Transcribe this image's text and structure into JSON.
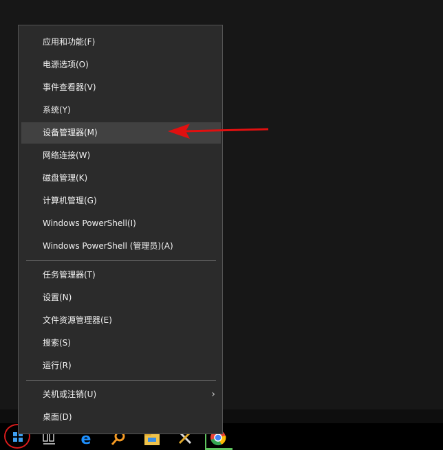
{
  "menu": {
    "items": [
      {
        "label": "应用和功能(F)"
      },
      {
        "label": "电源选项(O)"
      },
      {
        "label": "事件查看器(V)"
      },
      {
        "label": "系统(Y)"
      },
      {
        "label": "设备管理器(M)",
        "highlighted": true
      },
      {
        "label": "网络连接(W)"
      },
      {
        "label": "磁盘管理(K)"
      },
      {
        "label": "计算机管理(G)"
      },
      {
        "label": "Windows PowerShell(I)"
      },
      {
        "label": "Windows PowerShell (管理员)(A)"
      },
      {
        "label": "任务管理器(T)"
      },
      {
        "label": "设置(N)"
      },
      {
        "label": "文件资源管理器(E)"
      },
      {
        "label": "搜索(S)"
      },
      {
        "label": "运行(R)"
      },
      {
        "label": "关机或注销(U)",
        "has_submenu": true
      },
      {
        "label": "桌面(D)"
      }
    ],
    "submenu_chevron": "›"
  },
  "taskbar": {
    "icons": [
      "windows-start-icon",
      "task-view-icon",
      "edge-browser-icon",
      "search-app-icon",
      "file-explorer-icon",
      "tools-icon",
      "chrome-icon"
    ]
  },
  "colors": {
    "menu_bg": "#2b2b2b",
    "highlight_bg": "#414141",
    "arrow": "#e01010",
    "start_circle": "#d81b1b",
    "windows_blue": "#3ea0f1"
  }
}
